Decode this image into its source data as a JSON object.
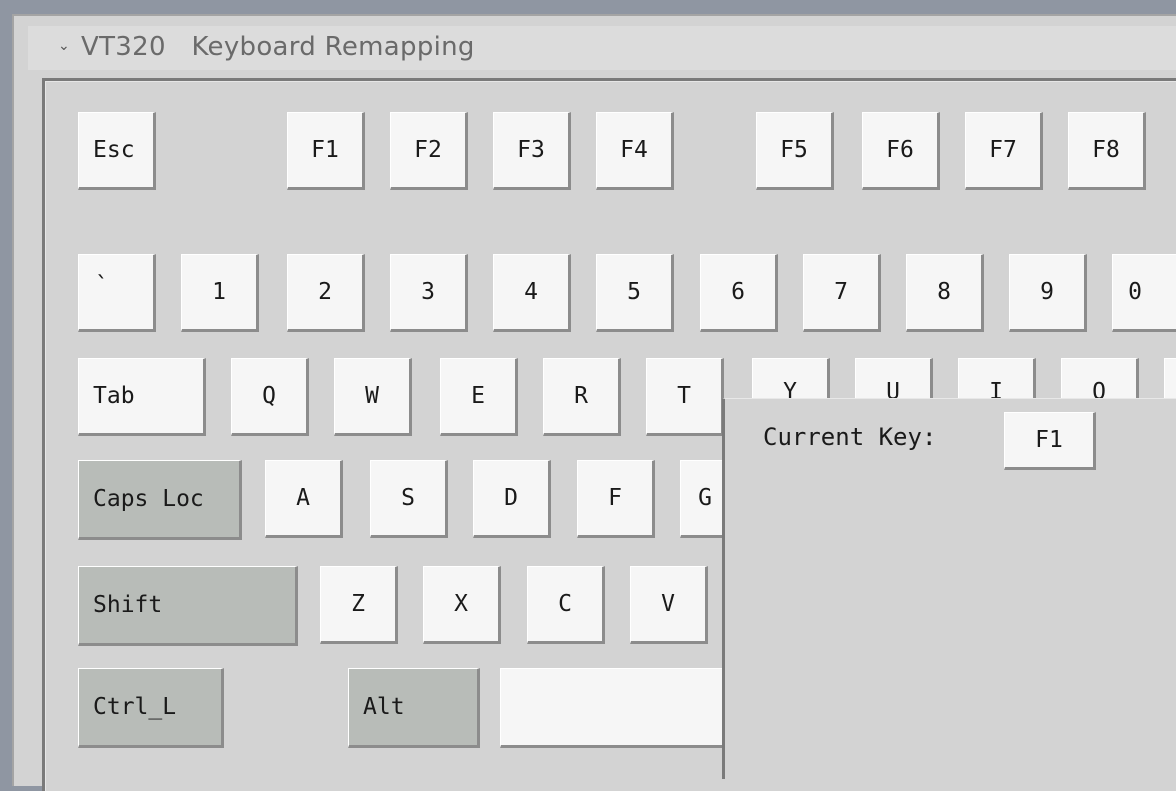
{
  "window": {
    "title_chevron": "⌄",
    "title": "VT320   Keyboard Remapping"
  },
  "keyboard": {
    "function_row": [
      "Esc",
      "F1",
      "F2",
      "F3",
      "F4",
      "F5",
      "F6",
      "F7",
      "F8"
    ],
    "number_row": [
      "`",
      "1",
      "2",
      "3",
      "4",
      "5",
      "6",
      "7",
      "8",
      "9",
      "0"
    ],
    "qwerty_row": [
      "Tab",
      "Q",
      "W",
      "E",
      "R",
      "T",
      "Y",
      "U",
      "I",
      "O"
    ],
    "home_row": [
      "Caps Loc",
      "A",
      "S",
      "D",
      "F",
      "G"
    ],
    "shift_row": [
      "Shift",
      "Z",
      "X",
      "C",
      "V"
    ],
    "bottom_row": [
      "Ctrl_L",
      "Alt",
      ""
    ]
  },
  "current_key_panel": {
    "label": "Current Key:",
    "key": "F1"
  },
  "colors": {
    "key_face": "#f6f6f6",
    "modifier_key_face": "#b8bcb8",
    "panel_background": "#d3d3d3"
  }
}
